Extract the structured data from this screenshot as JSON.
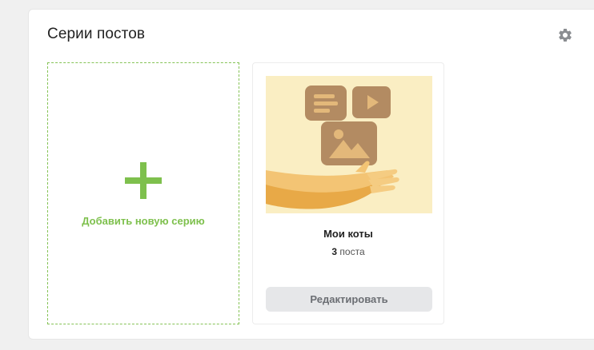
{
  "panel": {
    "title": "Серии постов",
    "settings_icon": "gear-icon"
  },
  "add_card": {
    "icon": "plus-icon",
    "label": "Добавить новую серию"
  },
  "series": [
    {
      "cover_icon": "content-illustration",
      "name": "Мои коты",
      "count": "3",
      "count_unit": "поста",
      "edit_label": "Редактировать"
    }
  ],
  "colors": {
    "accent_green": "#7ec04d",
    "cover_bg": "#faeec3",
    "cover_tile": "#b38b62",
    "hand": "#f3be66",
    "button_bg": "#e6e7e9",
    "button_text": "#6b6e73"
  }
}
